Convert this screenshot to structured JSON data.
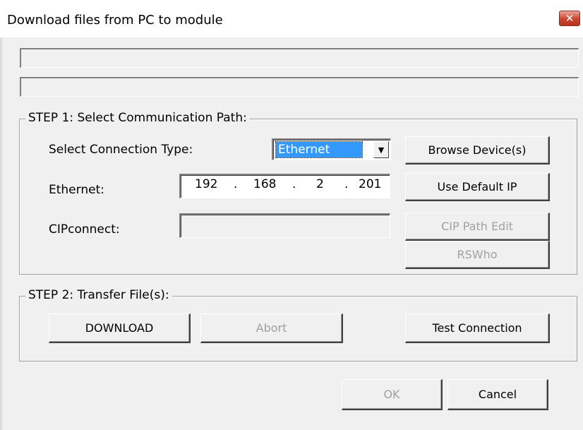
{
  "window": {
    "title": "Download files from PC to module",
    "close_glyph": "✕"
  },
  "step1": {
    "legend": "STEP 1: Select Communication Path:",
    "connection_type_label": "Select Connection Type:",
    "connection_type_value": "Ethernet",
    "browse_button": "Browse Device(s)",
    "ethernet_label": "Ethernet:",
    "ip": [
      "192",
      "168",
      "2",
      "201"
    ],
    "ip_dot": ".",
    "default_ip_button": "Use Default IP",
    "cipconnect_label": "CIPconnect:",
    "cipconnect_value": "",
    "cip_path_button": "CIP Path Edit",
    "rswho_button": "RSWho"
  },
  "step2": {
    "legend": "STEP 2: Transfer File(s):",
    "download_button": "DOWNLOAD",
    "abort_button": "Abort",
    "test_button": "Test Connection"
  },
  "footer": {
    "ok_button": "OK",
    "cancel_button": "Cancel"
  },
  "status": {
    "line1": "",
    "line2": ""
  },
  "icons": {
    "dropdown": "▼"
  },
  "colors": {
    "selection": "#3399ff",
    "close_button": "#c9452e"
  }
}
